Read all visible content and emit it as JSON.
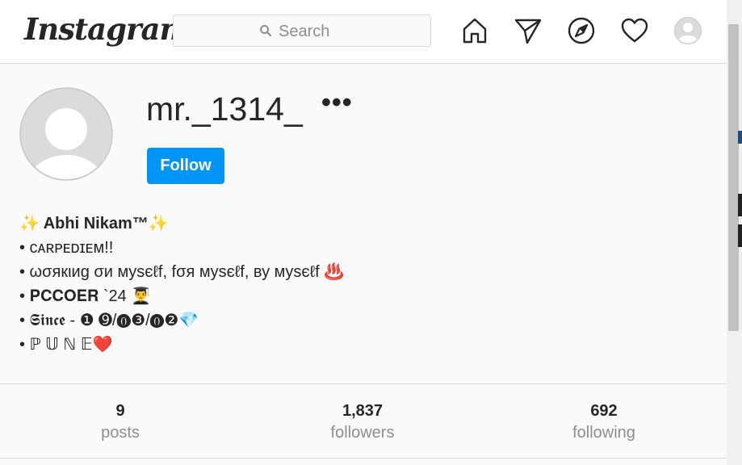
{
  "header": {
    "logo_text": "Instagram",
    "search": {
      "placeholder": "Search"
    },
    "nav_icons": [
      "home-icon",
      "direct-icon",
      "explore-icon",
      "activity-icon",
      "profile-avatar"
    ]
  },
  "profile": {
    "username": "mr._1314_",
    "more_label": "•••",
    "follow_label": "Follow",
    "bio": {
      "name_line": "✨ Abhi Nikam™✨",
      "lines": [
        "• ᴄᴀʀᴘᴇᴅɪᴇᴍ!!",
        "• ωσякιиg σи мyѕєℓf, fσя мyѕєℓf, ву мyѕєℓf ♨️",
        "• 𝐏𝐂𝐂𝐎𝐄𝐑 `24 👨‍🎓",
        "• 𝕾𝖎𝖓𝖈𝖊 - ❶ ➒/⓿❸/⓿❷💎",
        "• ℙ 𝕌 ℕ 𝔼❤️"
      ]
    },
    "stats": [
      {
        "value": "9",
        "label": "posts"
      },
      {
        "value": "1,837",
        "label": "followers"
      },
      {
        "value": "692",
        "label": "following"
      }
    ]
  },
  "colors": {
    "accent": "#0095f6",
    "border": "#dbdbdb",
    "background": "#fafafa",
    "muted_text": "#8e8e8e"
  }
}
